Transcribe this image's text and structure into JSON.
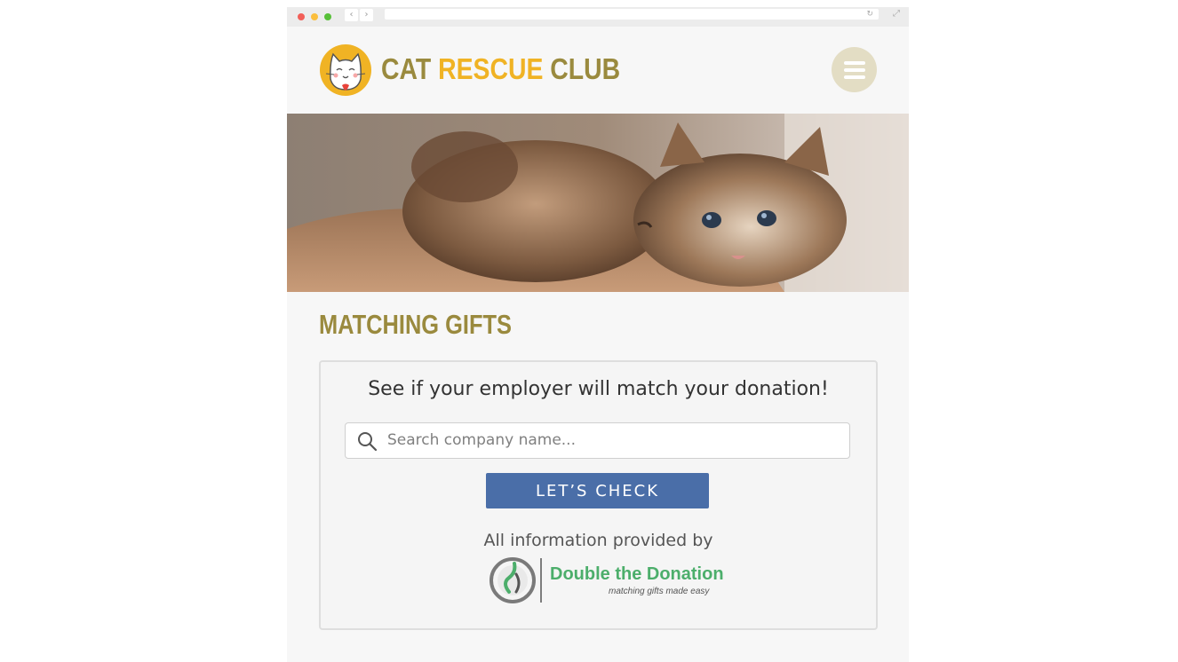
{
  "brand": {
    "word1": "CAT",
    "word2": "RESCUE",
    "word3": "CLUB"
  },
  "page": {
    "title": "MATCHING GIFTS"
  },
  "matching_widget": {
    "heading": "See if your employer will match your donation!",
    "search_placeholder": "Search company name...",
    "button_label": "LET’S CHECK",
    "provided_by": "All information provided by",
    "partner_name": "Double the Donation",
    "partner_tagline": "matching gifts made easy"
  },
  "colors": {
    "brand_olive": "#9a8a3e",
    "brand_gold": "#f0b324",
    "button_blue": "#4a6ea8",
    "partner_green": "#4cae6b",
    "menu_circle": "#e3ddc4"
  },
  "icons": {
    "menu": "hamburger-icon",
    "search": "search-icon",
    "logo": "cat-face-logo"
  }
}
